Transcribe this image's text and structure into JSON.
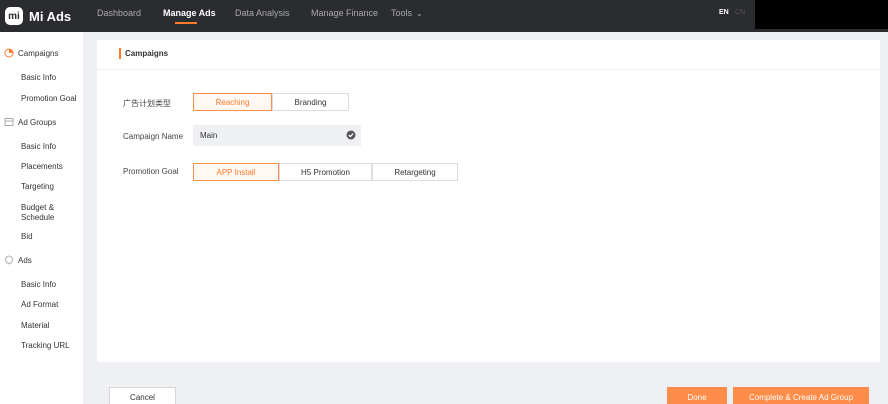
{
  "brand": {
    "logo_mark": "mi",
    "name": "Mi Ads",
    "accent": "#ff7a2b"
  },
  "nav": {
    "items": [
      {
        "label": "Dashboard"
      },
      {
        "label": "Manage Ads"
      },
      {
        "label": "Data Analysis"
      },
      {
        "label": "Manage Finance"
      },
      {
        "label": "Tools"
      }
    ],
    "active": "Manage Ads",
    "lang_en": "EN",
    "lang_cn": "CN"
  },
  "sidebar": {
    "campaigns": {
      "label": "Campaigns",
      "icon": "campaign-icon",
      "items": [
        "Basic Info",
        "Promotion Goal"
      ]
    },
    "ad_groups": {
      "label": "Ad Groups",
      "icon": "ad-group-icon",
      "items": [
        "Basic Info",
        "Placements",
        "Targeting",
        "Budget & Schedule",
        "Bid"
      ]
    },
    "ads": {
      "label": "Ads",
      "icon": "ads-icon",
      "items": [
        "Basic Info",
        "Ad Format",
        "Material",
        "Tracking URL"
      ]
    }
  },
  "form": {
    "title": "Campaigns",
    "campaign_type": {
      "label": "广告计划类型",
      "options": [
        "Reaching",
        "Branding"
      ],
      "selected": "Reaching"
    },
    "campaign_name": {
      "label": "Campaign Name",
      "value": "Main"
    },
    "promotion_goal": {
      "label": "Promotion Goal",
      "options": [
        "APP Install",
        "H5 Promotion",
        "Retargeting"
      ],
      "selected": "APP Install"
    }
  },
  "footer": {
    "cancel": "Cancel",
    "done": "Done",
    "complete": "Complete & Create Ad Group"
  }
}
